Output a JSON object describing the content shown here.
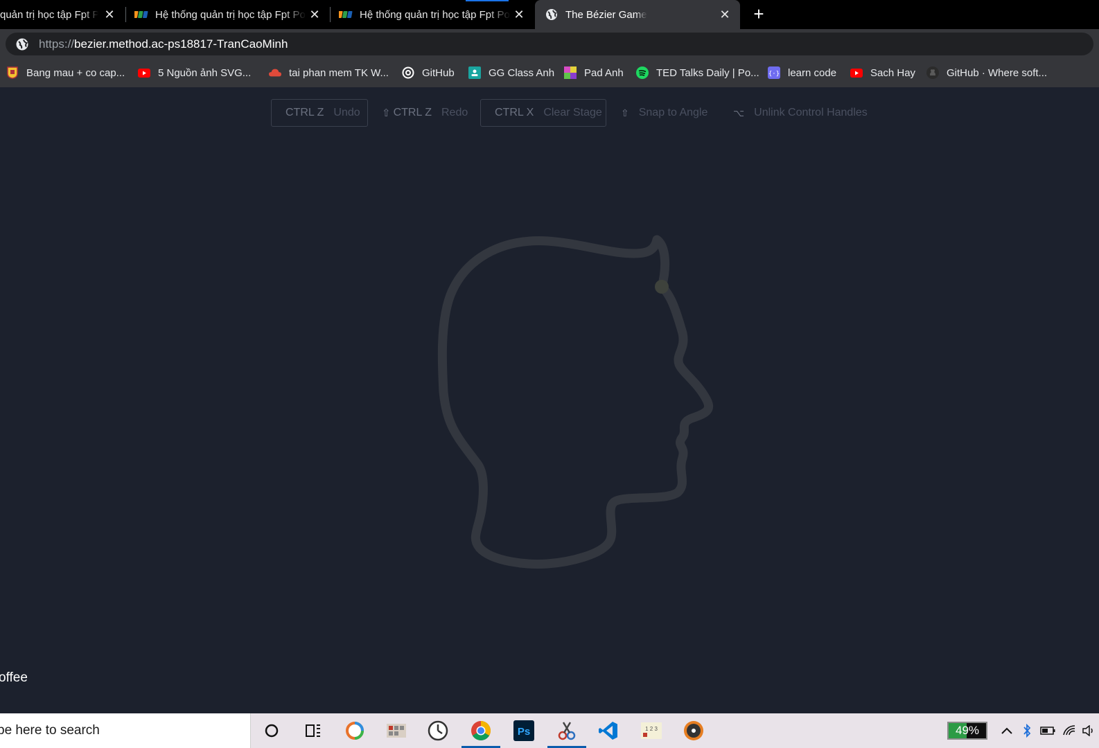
{
  "browser": {
    "tabs": [
      {
        "title": "quản trị học tập Fpt Po",
        "icon": "fpt-favicon",
        "active": false
      },
      {
        "title": "Hệ thống quản trị học tập Fpt Po",
        "icon": "fpt-favicon",
        "active": false
      },
      {
        "title": "Hệ thống quản trị học tập Fpt Po",
        "icon": "fpt-favicon",
        "active": false
      },
      {
        "title": "The Bézier Game",
        "icon": "globe-icon",
        "active": true
      }
    ],
    "close_glyph": "✕",
    "new_tab_glyph": "+",
    "address": {
      "scheme": "https://",
      "rest": "bezier.method.ac-ps18817-TranCaoMinh"
    },
    "bookmarks": [
      {
        "label": "Bang mau + co cap...",
        "icon": "crest-icon"
      },
      {
        "label": "5 Nguồn ảnh SVG...",
        "icon": "youtube-icon"
      },
      {
        "label": "tai phan mem TK W...",
        "icon": "cloud-icon"
      },
      {
        "label": "GitHub",
        "icon": "github-ring-icon"
      },
      {
        "label": "GG Class Anh",
        "icon": "classroom-icon"
      },
      {
        "label": "Pad Anh",
        "icon": "pad-icon"
      },
      {
        "label": "TED Talks Daily | Po...",
        "icon": "spotify-icon"
      },
      {
        "label": "learn code",
        "icon": "code-icon"
      },
      {
        "label": "Sach Hay",
        "icon": "youtube-icon"
      },
      {
        "label": "GitHub · Where soft...",
        "icon": "github-icon"
      }
    ]
  },
  "game": {
    "controls": {
      "undo": {
        "key": "CTRL Z",
        "action": "Undo"
      },
      "redo": {
        "glyph": "⇧",
        "key": "CTRL Z",
        "action": "Redo"
      },
      "clear": {
        "key": "CTRL X",
        "action": "Clear Stage"
      },
      "snap": {
        "glyph": "⇧",
        "action": "Snap to Angle"
      },
      "unlink": {
        "glyph": "⌥",
        "action": "Unlink Control Handles"
      }
    },
    "footer_fragment": "offee",
    "colors": {
      "background": "#1c212d",
      "guide_stroke": "#33373f"
    }
  },
  "taskbar": {
    "search_placeholder": "pe here to search",
    "apps": [
      "cortana-icon",
      "task-view-icon",
      "app-ring-icon",
      "app-grid-icon",
      "clock-app-icon",
      "chrome-icon",
      "photoshop-icon",
      "snipping-icon",
      "vscode-icon",
      "calculator-icon",
      "music-icon"
    ],
    "battery_percent": 49,
    "battery_label": "49%"
  }
}
